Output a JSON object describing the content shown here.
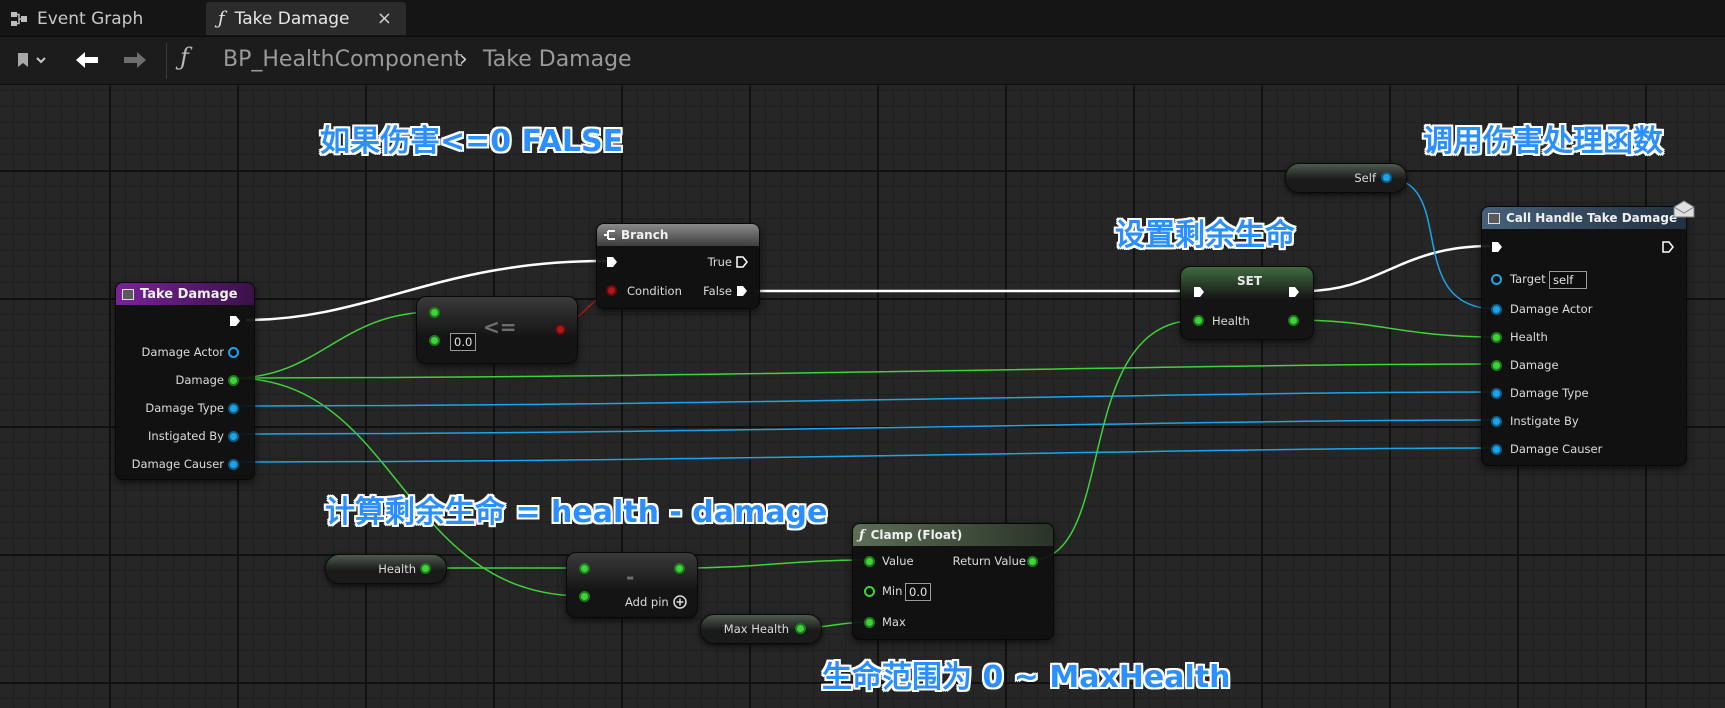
{
  "tabs": [
    {
      "label": "Event Graph",
      "icon": "event-graph-icon"
    },
    {
      "label": "Take Damage",
      "icon": "function-icon",
      "close": "×"
    }
  ],
  "breadcrumb": {
    "root": "BP_HealthComponent",
    "separator": "›",
    "current": "Take Damage"
  },
  "nodes": {
    "take_damage": {
      "title": "Take Damage",
      "pins": [
        "Damage Actor",
        "Damage",
        "Damage Type",
        "Instigated By",
        "Damage Causer"
      ]
    },
    "compare": {
      "op": "<=",
      "default": "0.0"
    },
    "branch": {
      "title": "Branch",
      "true_label": "True",
      "condition_label": "Condition",
      "false_label": "False"
    },
    "set": {
      "title": "SET",
      "pin": "Health"
    },
    "self_var": {
      "label": "Self"
    },
    "call_handle": {
      "title": "Call Handle Take Damage",
      "target_label": "Target",
      "target_value": "self",
      "pins": [
        "Damage Actor",
        "Health",
        "Damage",
        "Damage Type",
        "Instigate By",
        "Damage Causer"
      ]
    },
    "health_var": {
      "label": "Health"
    },
    "subtract": {
      "op": "-",
      "add_pin": "Add pin"
    },
    "max_health_var": {
      "label": "Max Health"
    },
    "clamp": {
      "title": "Clamp (Float)",
      "value_label": "Value",
      "return_label": "Return Value",
      "min_label": "Min",
      "min_value": "0.0",
      "max_label": "Max"
    }
  },
  "annotations": {
    "branch_note": "如果伤害<=0 FALSE",
    "call_note": "调用伤害处理函数",
    "set_note": "设置剩余生命",
    "calc_note": "计算剩余生命 = health - damage",
    "range_note": "生命范围为 0 ~ MaxHealth"
  },
  "colors": {
    "exec": "#ffffff",
    "float_pin": "#3fd23a",
    "object_pin": "#1ba5e8",
    "bool_pin": "#b01818",
    "function_header": "#6b1d8a",
    "annotation": "#2b8fff"
  }
}
